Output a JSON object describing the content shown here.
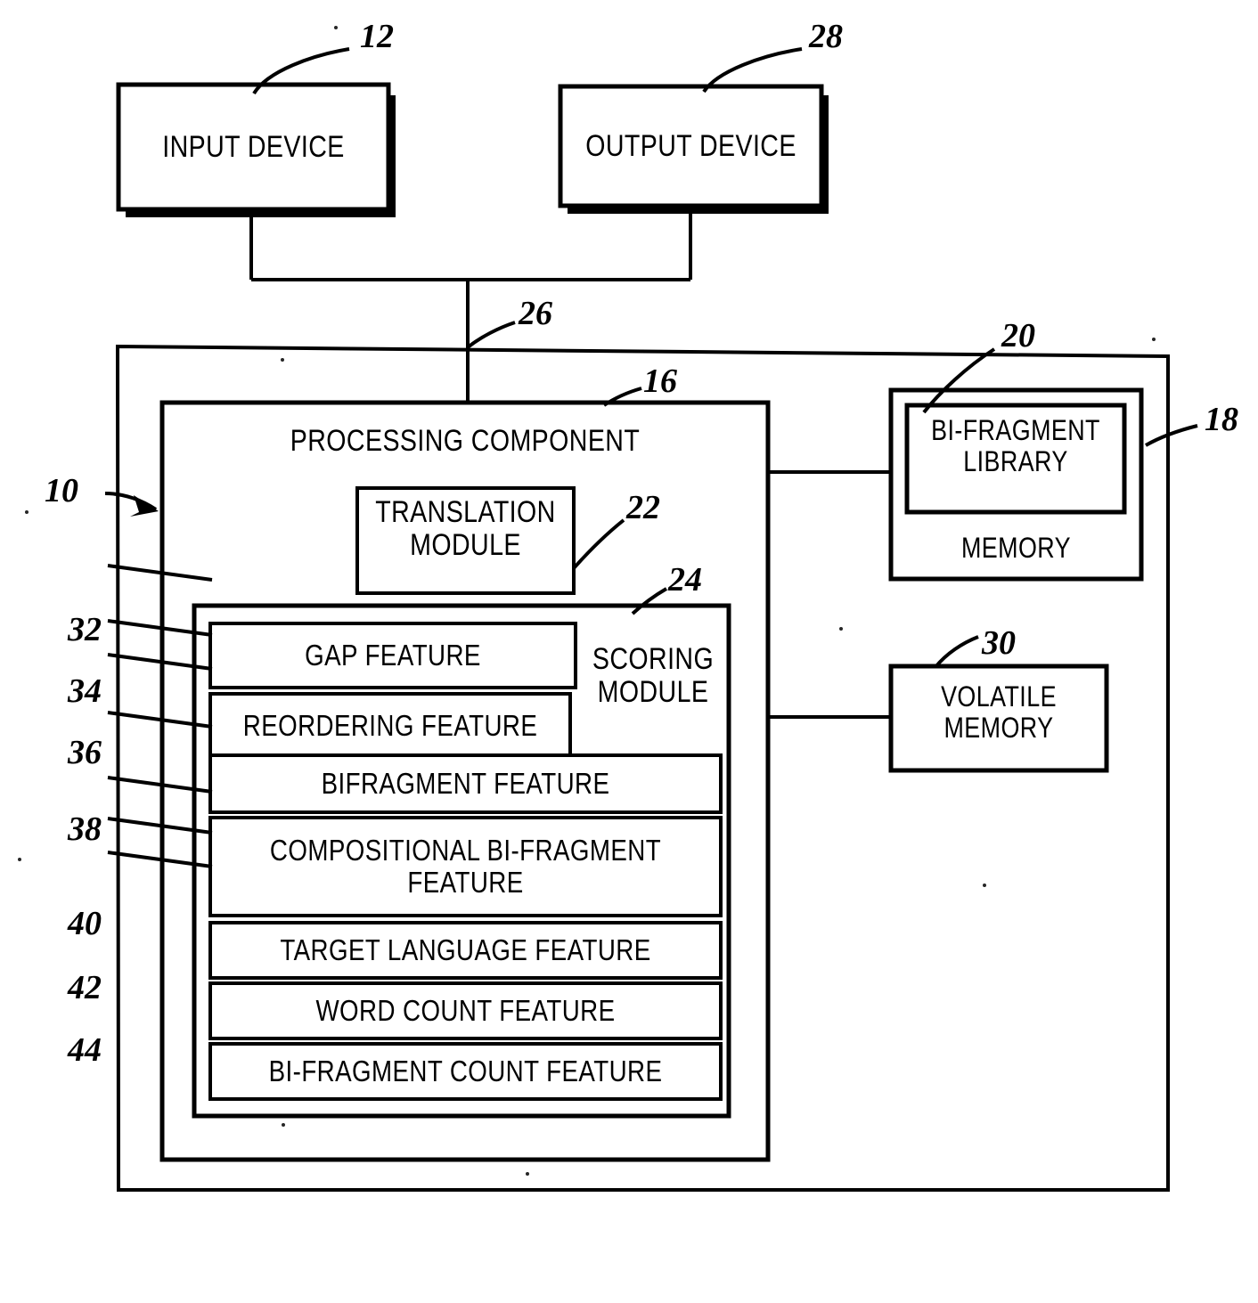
{
  "figure": {
    "type": "patent-block-diagram",
    "description": "Machine translation system block diagram"
  },
  "blocks": {
    "input_device": {
      "label": "INPUT DEVICE",
      "ref": "12"
    },
    "output_device": {
      "label": "OUTPUT DEVICE",
      "ref": "28"
    },
    "system": {
      "ref": "10"
    },
    "bus": {
      "ref": "26"
    },
    "processing_component": {
      "label": "PROCESSING COMPONENT",
      "ref": "16"
    },
    "translation_module": {
      "label_line1": "TRANSLATION",
      "label_line2": "MODULE",
      "ref": "22"
    },
    "scoring_module": {
      "label_line1": "SCORING",
      "label_line2": "MODULE",
      "ref": "24"
    },
    "memory": {
      "label": "MEMORY",
      "ref": "18"
    },
    "bifragment_library": {
      "label_line1": "BI-FRAGMENT",
      "label_line2": "LIBRARY",
      "ref": "20"
    },
    "volatile_memory": {
      "label_line1": "VOLATILE",
      "label_line2": "MEMORY",
      "ref": "30"
    }
  },
  "features": [
    {
      "label": "GAP FEATURE",
      "ref": "32"
    },
    {
      "label": "REORDERING FEATURE",
      "ref": "34"
    },
    {
      "label": "BIFRAGMENT FEATURE",
      "ref": "36"
    },
    {
      "label_line1": "COMPOSITIONAL BI-FRAGMENT",
      "label_line2": "FEATURE",
      "ref": "38"
    },
    {
      "label": "TARGET LANGUAGE FEATURE",
      "ref": "40"
    },
    {
      "label": "WORD COUNT FEATURE",
      "ref": "42"
    },
    {
      "label": "BI-FRAGMENT COUNT FEATURE",
      "ref": "44"
    }
  ],
  "colors": {
    "ink": "#000000",
    "paper": "#ffffff"
  }
}
